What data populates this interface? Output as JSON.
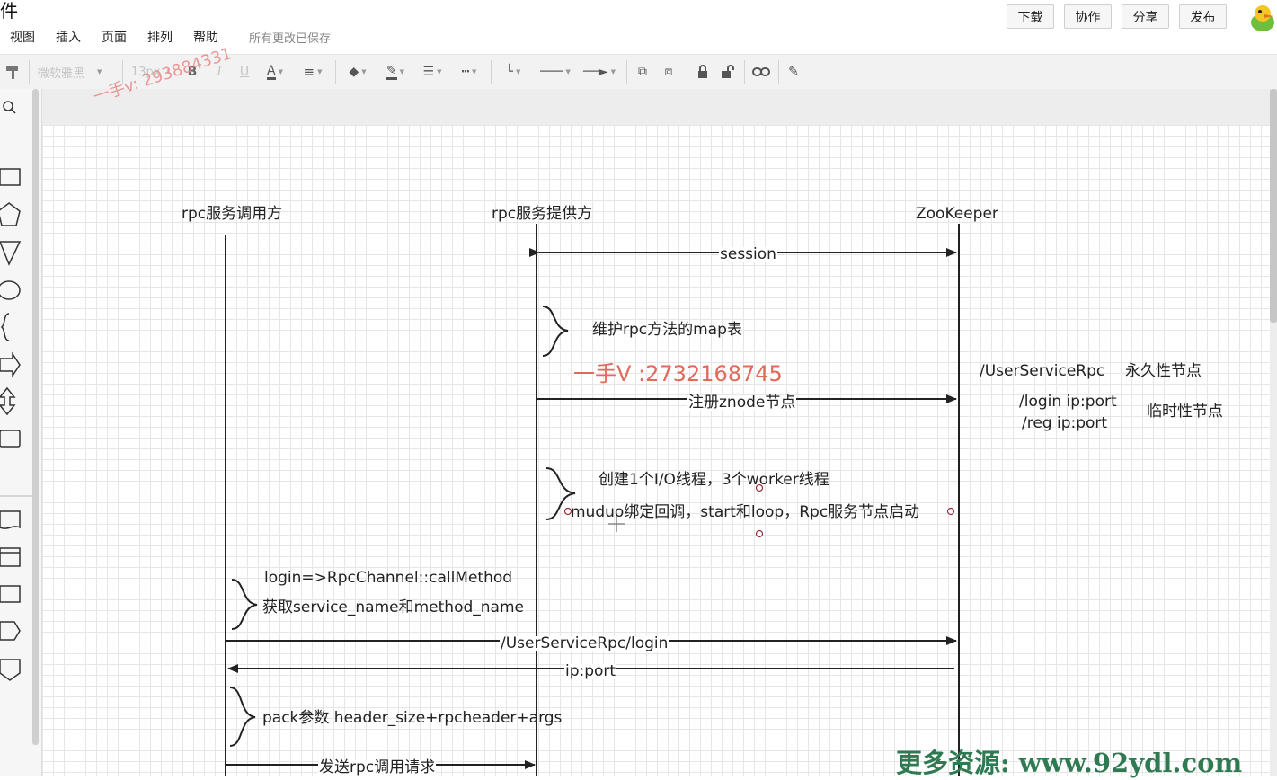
{
  "menubar": {
    "title_fragment": "件",
    "items": [
      "视图",
      "插入",
      "页面",
      "排列",
      "帮助"
    ],
    "save_status": "所有更改已保存"
  },
  "top_buttons": {
    "download": "下载",
    "collab": "协作",
    "share": "分享",
    "publish": "发布"
  },
  "toolbar": {
    "font_family": "微软雅黑",
    "font_size": "13px",
    "bold": "B",
    "italic": "I",
    "underline": "U",
    "font_color": "A"
  },
  "diagram": {
    "actors": {
      "caller": "rpc服务调用方",
      "provider": "rpc服务提供方",
      "zookeeper": "ZooKeeper"
    },
    "messages": {
      "session": "session",
      "register": "注册znode节点",
      "lookup": "/UserServiceRpc/login",
      "ip_port": "ip:port",
      "send_request": "发送rpc调用请求"
    },
    "notes": {
      "map_table": "维护rpc方法的map表",
      "threads": "创建1个I/O线程，3个worker线程",
      "muduo": "muduo绑定回调，start和loop，Rpc服务节点启动",
      "call_method": "login=>RpcChannel::callMethod",
      "get_names": "获取service_name和method_name",
      "pack": "pack参数 header_size+rpcheader+args"
    },
    "zk_tree": {
      "root": "/UserServiceRpc",
      "root_type": "永久性节点",
      "login": "/login  ip:port",
      "reg": "/reg  ip:port",
      "child_type": "临时性节点"
    }
  },
  "watermarks": {
    "diagonal": "一手v: 293884331",
    "red": "一手V :2732168745",
    "footer": "更多资源: www.92ydl.com"
  },
  "colors": {
    "line": "#222222",
    "grid": "#e6e6e6",
    "selection": "#9b2b3a"
  }
}
